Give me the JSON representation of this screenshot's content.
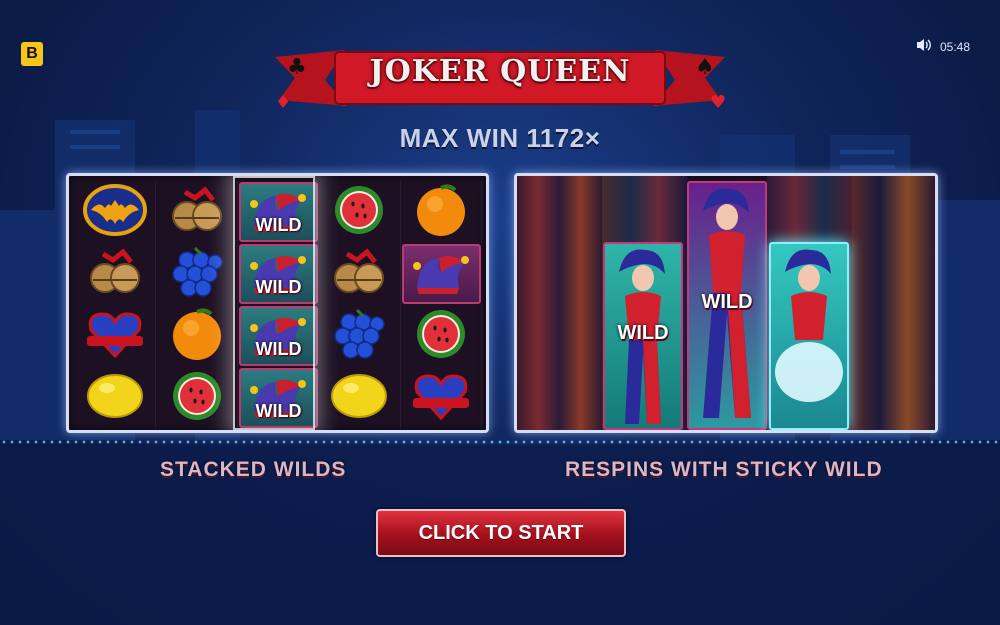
{
  "brand_badge": "B",
  "status": {
    "time": "05:48",
    "sound_icon": "speaker-icon"
  },
  "logo": {
    "text": "JOKER QUEEN"
  },
  "max_win": "MAX WIN 1172×",
  "left_panel": {
    "caption": "STACKED WILDS",
    "wild_label": "WILD",
    "reels": [
      [
        "bat-emblem-icon",
        "bells-icon",
        "heart-icon",
        "lemon-icon"
      ],
      [
        "bells-icon",
        "grapes-icon",
        "orange-icon",
        "watermelon-icon"
      ],
      [
        "jester-hat-wild-icon",
        "jester-hat-wild-icon",
        "jester-hat-wild-icon",
        "jester-hat-wild-icon"
      ],
      [
        "watermelon-icon",
        "bells-icon",
        "grapes-icon",
        "lemon-icon"
      ],
      [
        "orange-icon",
        "jester-hat-icon",
        "watermelon-icon",
        "heart-icon"
      ]
    ]
  },
  "right_panel": {
    "caption": "RESPINS WITH STICKY WILD",
    "wild_label": "WILD"
  },
  "start_button": "CLICK TO START"
}
